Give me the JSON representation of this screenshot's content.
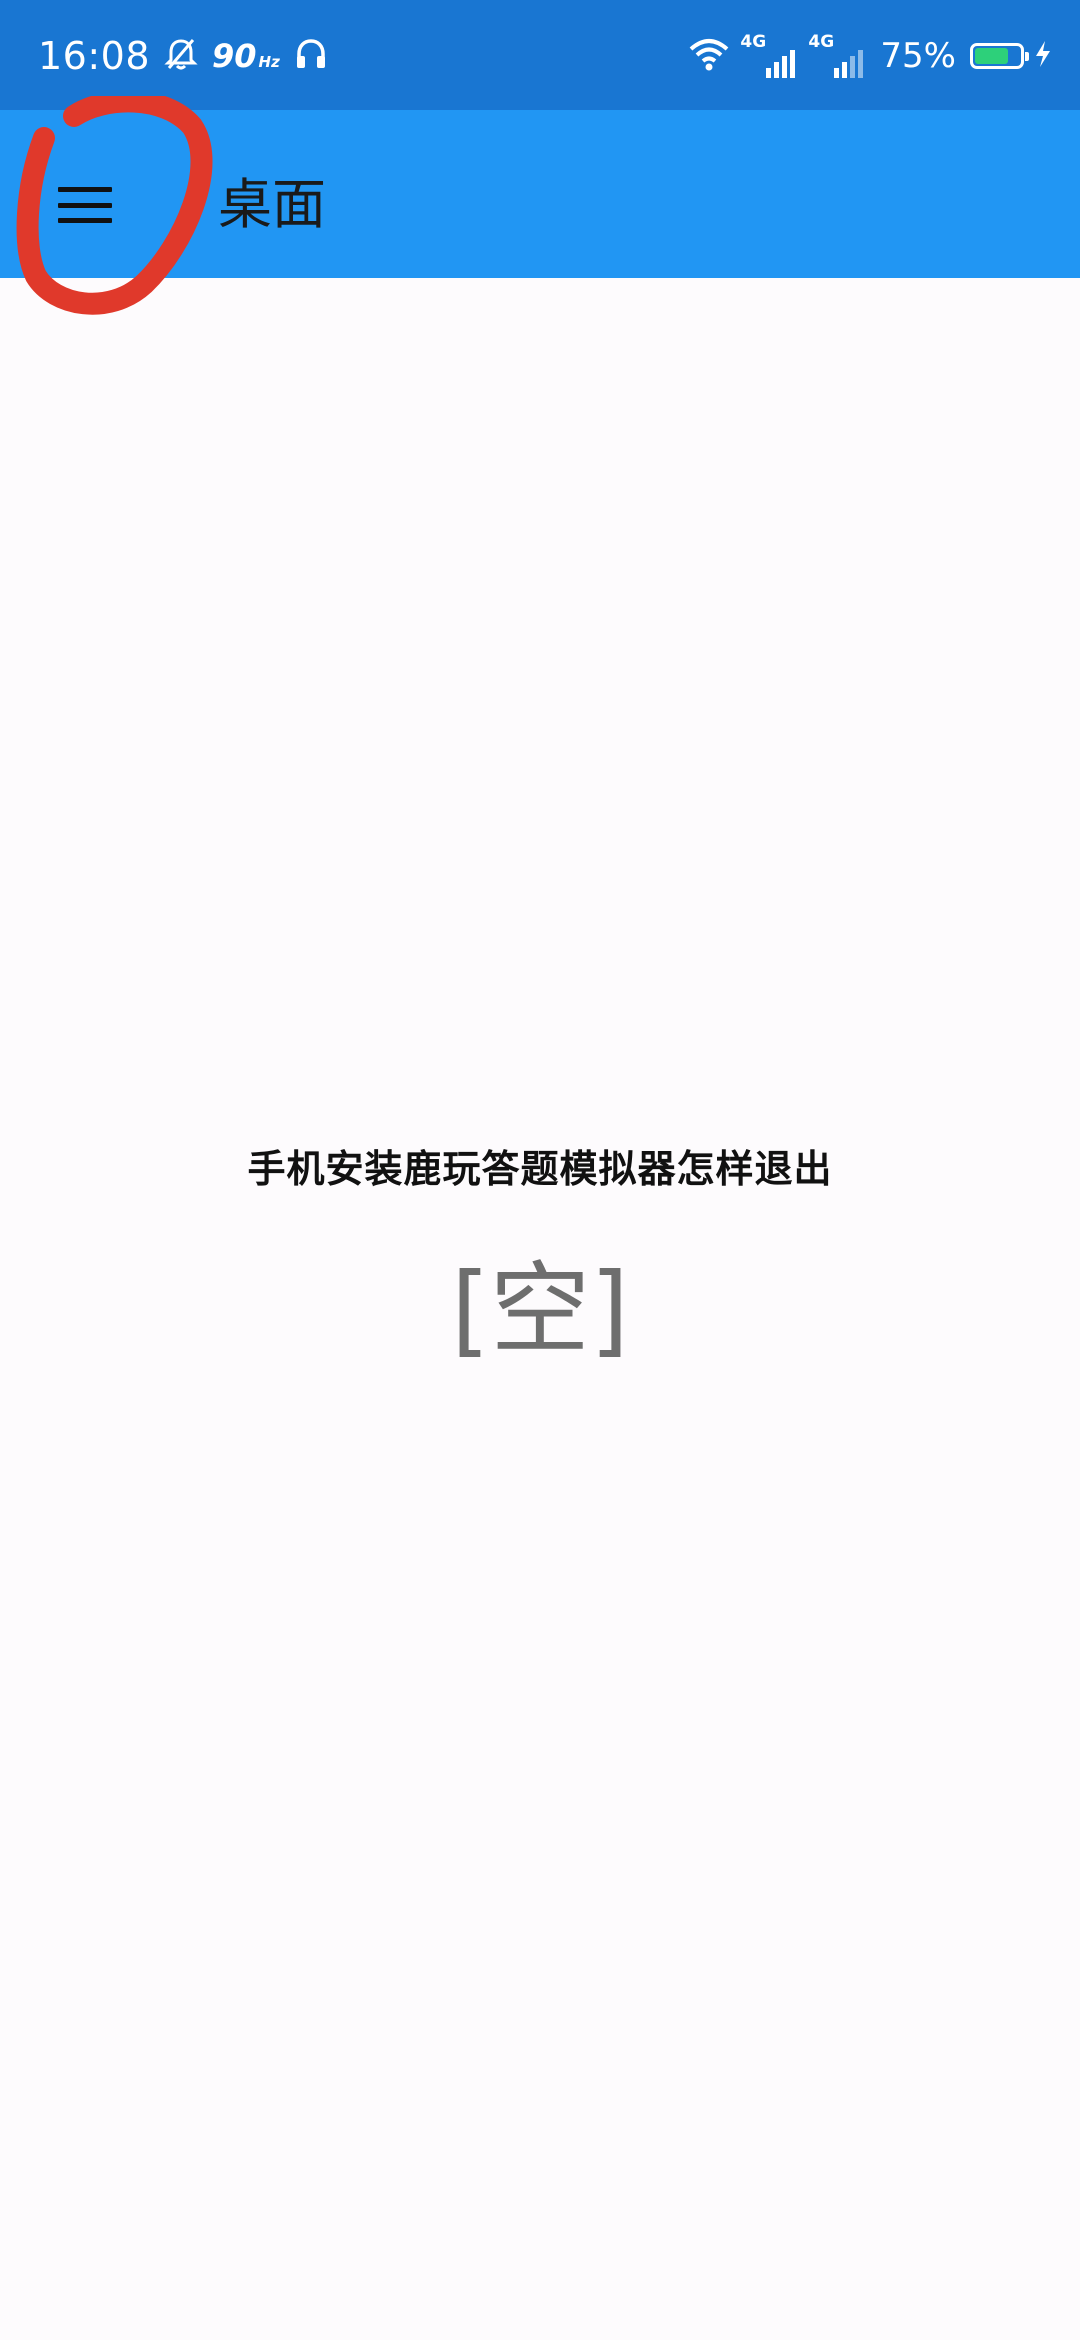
{
  "status_bar": {
    "time": "16:08",
    "refresh_rate": "90",
    "refresh_unit": "Hz",
    "signal1_label": "4G",
    "signal2_label": "4G",
    "battery_percent": "75%",
    "battery_level": 0.75,
    "icons": [
      "alarm-off-icon",
      "headphones-icon",
      "wifi-icon",
      "signal-icon",
      "battery-icon",
      "charging-bolt-icon"
    ]
  },
  "app_bar": {
    "menu_icon": "hamburger-menu-icon",
    "title": "桌面",
    "background": "#2196f3"
  },
  "main": {
    "headline": "手机安装鹿玩答题模拟器怎样退出",
    "empty_text": "[空]"
  },
  "colors": {
    "status_bar": "#1976d2",
    "app_bar": "#2196f3",
    "annotation": "#e0392b",
    "background": "#fdfbfd"
  }
}
